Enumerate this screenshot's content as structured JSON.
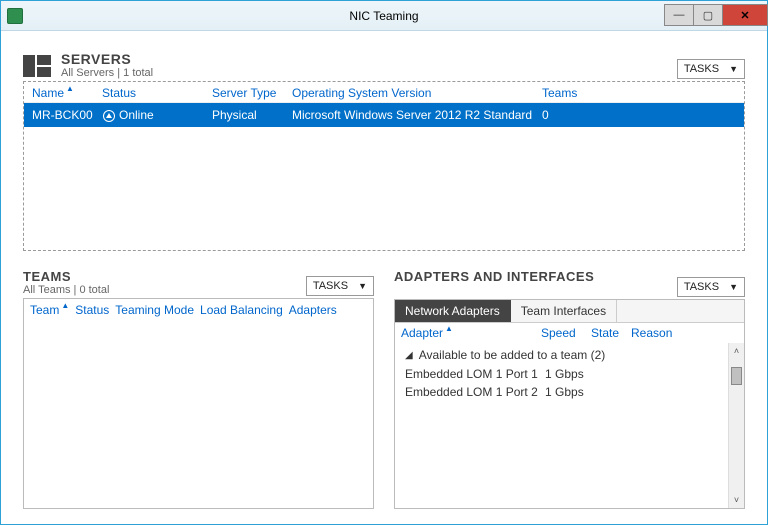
{
  "window": {
    "title": "NIC Teaming"
  },
  "titlebar_buttons": {
    "min": "—",
    "max": "▢",
    "close": "✕"
  },
  "servers": {
    "title": "SERVERS",
    "subtitle": "All Servers | 1 total",
    "tasks_label": "TASKS",
    "columns": {
      "name": "Name",
      "status": "Status",
      "server_type": "Server Type",
      "os_version": "Operating System Version",
      "teams": "Teams"
    },
    "row": {
      "name": "MR-BCK00",
      "status": "Online",
      "server_type": "Physical",
      "os_version": "Microsoft Windows Server 2012 R2 Standard",
      "teams": "0"
    }
  },
  "teams": {
    "title": "TEAMS",
    "subtitle": "All Teams | 0 total",
    "tasks_label": "TASKS",
    "columns": {
      "team": "Team",
      "status": "Status",
      "teaming_mode": "Teaming Mode",
      "load_balancing": "Load Balancing",
      "adapters": "Adapters"
    }
  },
  "adapters": {
    "title": "ADAPTERS AND INTERFACES",
    "tasks_label": "TASKS",
    "tabs": {
      "network_adapters": "Network Adapters",
      "team_interfaces": "Team Interfaces"
    },
    "columns": {
      "adapter": "Adapter",
      "speed": "Speed",
      "state": "State",
      "reason": "Reason"
    },
    "group_label": "Available to be added to a team (2)",
    "items": [
      {
        "name": "Embedded LOM 1 Port 1",
        "speed": "1 Gbps"
      },
      {
        "name": "Embedded LOM 1 Port 2",
        "speed": "1 Gbps"
      }
    ]
  }
}
